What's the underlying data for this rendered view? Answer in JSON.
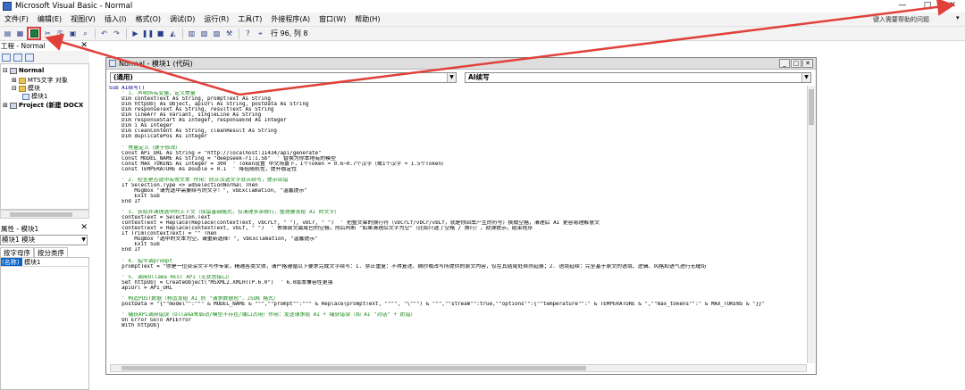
{
  "window": {
    "title": "Microsoft Visual Basic - Normal",
    "controls": [
      "—",
      "□",
      "✕"
    ]
  },
  "menu": {
    "items": [
      "文件(F)",
      "编辑(E)",
      "视图(V)",
      "插入(I)",
      "格式(O)",
      "调试(D)",
      "运行(R)",
      "工具(T)",
      "外接程序(A)",
      "窗口(W)",
      "帮助(H)"
    ],
    "help_box": "键入需要帮助的问题",
    "help_arrow": "▾"
  },
  "toolbar": {
    "position": "行 96, 列 8"
  },
  "project_pane": {
    "title": "工程 - Normal",
    "close": "✕",
    "tree": [
      {
        "label": "Normal",
        "icon": "project-icon"
      },
      {
        "label": "MTS文字 对象",
        "icon": "folder-icon"
      },
      {
        "label": "模块",
        "icon": "folder-icon"
      },
      {
        "label": "模块1",
        "icon": "module-icon"
      },
      {
        "label": "Project (新建 DOCX",
        "icon": "project-icon"
      }
    ]
  },
  "properties_pane": {
    "title": "属性 - 模块1",
    "close": "✕",
    "object": "模块1 模块",
    "tabs": [
      "按字母序",
      "按分类序"
    ],
    "rows": [
      {
        "key": "(名称)",
        "value": "模块1"
      }
    ]
  },
  "code_window": {
    "title": "Normal - 模块1 (代码)",
    "object_combo": "(通用)",
    "proc_combo": "AI续写",
    "controls": [
      "_",
      "□",
      "✕"
    ],
    "lines": [
      {
        "t": "Sub AI续写()",
        "c": "kw"
      },
      {
        "t": "    ' 1. 声明所有变量，定义常量",
        "c": "cm"
      },
      {
        "t": "    Dim contextText As String, promptText As String",
        "c": ""
      },
      {
        "t": "    Dim httpObj As Object, apiUrl As String, postData As String",
        "c": ""
      },
      {
        "t": "    Dim responseText As String, resultText As String",
        "c": ""
      },
      {
        "t": "    Dim lineArr As Variant, singleLine As String",
        "c": ""
      },
      {
        "t": "    Dim responseStart As Integer, responseEnd As Integer",
        "c": ""
      },
      {
        "t": "    Dim i As Integer",
        "c": ""
      },
      {
        "t": "    Dim cleanContent As String, cleanResult As String",
        "c": ""
      },
      {
        "t": "    Dim duplicatePos As Integer",
        "c": ""
      },
      {
        "t": "",
        "c": ""
      },
      {
        "t": "    ' 常量定义（便于修改）",
        "c": "cm"
      },
      {
        "t": "    Const API_URL As String = \"http://localhost:11434/api/generate\"",
        "c": ""
      },
      {
        "t": "    Const MODEL_NAME As String = \"deepseek-r1:1.5b\"  ' 替换为你本地有的模型",
        "c": ""
      },
      {
        "t": "    Const MAX_TOKENS As Integer = 300  ' Token设置 中文场景下，1个Token ≈ 0.6~0.7个汉字（或1个汉字 ≈ 1.5个Token）",
        "c": ""
      },
      {
        "t": "    Const TEMPERATURE As Double = 0.1  ' 降低随机性，提升稳定性",
        "c": ""
      },
      {
        "t": "",
        "c": ""
      },
      {
        "t": "    ' 2. 检查是否选中有效文本 作用：防止没选文字就点续写，提示出错",
        "c": "cm"
      },
      {
        "t": "    If Selection.Type <> wdSelectionNormal Then",
        "c": ""
      },
      {
        "t": "        MsgBox \"请先选中需要续写的文字！\", vbExclamation, \"温馨提示\"",
        "c": ""
      },
      {
        "t": "        Exit Sub",
        "c": ""
      },
      {
        "t": "    End If",
        "c": ""
      },
      {
        "t": "",
        "c": ""
      },
      {
        "t": "    ' 3. 获取并清理选中的上下文（保留基础格式，仅清理多余换行，整理要发给 AI 的文字）",
        "c": "cm"
      },
      {
        "t": "    contextText = Selection.Text",
        "c": ""
      },
      {
        "t": "    contextText = Replace(Replace(contextText, vbCrLf, \" \"), vbCr, \" \")  ' 把整文章的换行符（vbCrLf/vbCr/vbLf，就是你回车产生的符号）换成空格，清理后 AI 更容易理解意文",
        "c": ""
      },
      {
        "t": "    contextText = Replace(contextText, vbLf, \" \")  ' 去掉前文最尾巴的空格，然后判断 \"如果清理后文字为空\"（比如只选了空格 / 换行），就弹提示，结束程序",
        "c": ""
      },
      {
        "t": "    If Trim(contextText) = \"\" Then",
        "c": ""
      },
      {
        "t": "        MsgBox \"选中的文本为空，请重新选择！\", vbExclamation, \"温馨提示\"",
        "c": ""
      },
      {
        "t": "        Exit Sub",
        "c": ""
      },
      {
        "t": "    End If",
        "c": ""
      },
      {
        "t": "",
        "c": ""
      },
      {
        "t": "    ' 4. 指令调prompt",
        "c": "cm"
      },
      {
        "t": "    promptText = \"你是一位资深文字写作专家，精通各类文体，请严格遵循以下要求完成文字续写：1. 禁止重复：不得复述、摘抄或改写所提供的原文内容，仅在其结尾处自然延展；2. 语境延续：完全基于原文的语境、逻辑、风格和语气进行无缝衔",
        "c": ""
      },
      {
        "t": "",
        "c": ""
      },
      {
        "t": "    ' 5. 调用Ollama REST API（无状态接口）",
        "c": "cm"
      },
      {
        "t": "    Set httpObj = CreateObject(\"MSXML2.XMLHTTP.6.0\")  ' 6.0版本兼容性更强",
        "c": ""
      },
      {
        "t": "    apiUrl = API_URL",
        "c": ""
      },
      {
        "t": "",
        "c": ""
      },
      {
        "t": "    ' 构造POST数据（构造发给 AI 的 \"请求数据包\"，JSON 格式）",
        "c": "cm"
      },
      {
        "t": "    postData = \"{\"\"model\"\":\"\"\" & MODEL_NAME & \"\"\",\"\"prompt\"\":\"\"\" & Replace(promptText, \"\"\"\", \"\\\"\"\") & \"\"\",\"\"stream\"\":true,\"\"options\"\":{\"\"temperature\"\":\" & TEMPERATURE & \",\"\"max_tokens\"\":\" & MAX_TOKENS & \"}}\"",
        "c": ""
      },
      {
        "t": "",
        "c": ""
      },
      {
        "t": "    ' 捕获API调用错误（Ollama未启动/模型不存在/端口占用）作用：发送请求给 AI + 捕获错误（和 AI \"对话\" + 防错）",
        "c": "cm"
      },
      {
        "t": "    On Error GoTo APIError",
        "c": ""
      },
      {
        "t": "    With httpObj",
        "c": ""
      }
    ]
  }
}
